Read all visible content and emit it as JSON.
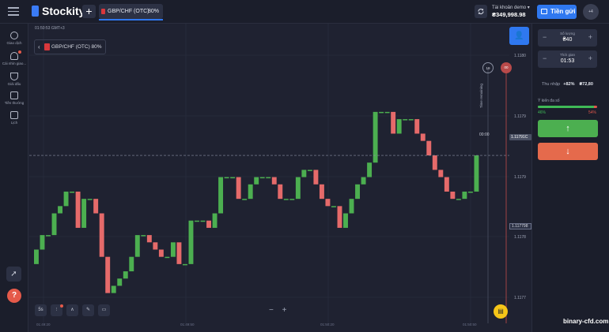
{
  "header": {
    "logo_text": "Stockity",
    "add_tab_label": "+",
    "active_tab": {
      "label": "GBP/CHF (OTC)",
      "payout": "80%"
    },
    "account_label": "Tài khoản demo ▾",
    "balance": "₴349,998.98",
    "deposit_label": "Tiền gửi",
    "avatar_label": "+4"
  },
  "sidebar": {
    "items": [
      {
        "label": "Giao dịch",
        "icon": "clock-icon"
      },
      {
        "label": "Cái nhìn giao...",
        "icon": "award-icon"
      },
      {
        "label": "Giải đấu",
        "icon": "trophy-icon"
      },
      {
        "label": "Tiền thưởng",
        "icon": "gift-icon"
      },
      {
        "label": "Lịch",
        "icon": "calendar-icon"
      }
    ],
    "rocket_icon": "rocket-icon",
    "help_label": "?"
  },
  "chart": {
    "clock": "01:50:53 GMT+3",
    "asset_label": "GBP/CHF (OTC) 80%",
    "time_remaining": "Time remaining",
    "timer": "00:00",
    "badge_gray": "19",
    "badge_red": "00",
    "current_price": "1.11791C",
    "marked_price": "1.117798",
    "timeframe": "5s",
    "zoom_minus": "−",
    "zoom_plus": "+",
    "price_ticks": [
      "1.1180",
      "1.1179",
      "1.1179",
      "1.1178",
      "1.1177"
    ],
    "time_ticks": [
      "01:49:20",
      "01:49:50",
      "01:50:20",
      "01:50:50"
    ]
  },
  "panel": {
    "amount": {
      "label": "Số lượng",
      "value": "₴40"
    },
    "duration": {
      "label": "Thời gian",
      "value": "01:53"
    },
    "payout_label": "Thu nhập",
    "payout_pct": "+82%",
    "payout_value": "₴72,80",
    "sentiment_label": "Ý kiến đa số",
    "sentiment_up": "46%",
    "sentiment_down": "54%",
    "sentiment_up_fraction": 0.95,
    "up_arrow": "↑",
    "down_arrow": "↓"
  },
  "watermark": "binary-cfd.com",
  "colors": {
    "up": "#4caf50",
    "down": "#e56a4c",
    "accent": "#2f78f0",
    "bg": "#1f2231"
  },
  "chart_data": {
    "type": "candlestick",
    "ylim": [
      1.11768,
      1.11805
    ],
    "candles": [
      {
        "o": 1.11774,
        "c": 1.11776
      },
      {
        "o": 1.11776,
        "c": 1.11778
      },
      {
        "o": 1.11778,
        "c": 1.11778
      },
      {
        "o": 1.11778,
        "c": 1.11781
      },
      {
        "o": 1.11781,
        "c": 1.11782
      },
      {
        "o": 1.11782,
        "c": 1.11784
      },
      {
        "o": 1.11784,
        "c": 1.11784
      },
      {
        "o": 1.11784,
        "c": 1.11779
      },
      {
        "o": 1.11779,
        "c": 1.11783
      },
      {
        "o": 1.11783,
        "c": 1.11783
      },
      {
        "o": 1.11783,
        "c": 1.11781
      },
      {
        "o": 1.11781,
        "c": 1.11775
      },
      {
        "o": 1.11775,
        "c": 1.1177
      },
      {
        "o": 1.1177,
        "c": 1.11771
      },
      {
        "o": 1.11771,
        "c": 1.11772
      },
      {
        "o": 1.11772,
        "c": 1.11773
      },
      {
        "o": 1.11773,
        "c": 1.11775
      },
      {
        "o": 1.11775,
        "c": 1.11778
      },
      {
        "o": 1.11778,
        "c": 1.11778
      },
      {
        "o": 1.11778,
        "c": 1.11777
      },
      {
        "o": 1.11777,
        "c": 1.11776
      },
      {
        "o": 1.11776,
        "c": 1.11775
      },
      {
        "o": 1.11775,
        "c": 1.11775
      },
      {
        "o": 1.11775,
        "c": 1.11777
      },
      {
        "o": 1.11777,
        "c": 1.11774
      },
      {
        "o": 1.11774,
        "c": 1.11774
      },
      {
        "o": 1.11774,
        "c": 1.1178
      },
      {
        "o": 1.1178,
        "c": 1.1178
      },
      {
        "o": 1.1178,
        "c": 1.1178
      },
      {
        "o": 1.1178,
        "c": 1.11779
      },
      {
        "o": 1.11779,
        "c": 1.11781
      },
      {
        "o": 1.11781,
        "c": 1.11786
      },
      {
        "o": 1.11786,
        "c": 1.11786
      },
      {
        "o": 1.11786,
        "c": 1.11786
      },
      {
        "o": 1.11786,
        "c": 1.11783
      },
      {
        "o": 1.11783,
        "c": 1.11783
      },
      {
        "o": 1.11783,
        "c": 1.11785
      },
      {
        "o": 1.11785,
        "c": 1.11786
      },
      {
        "o": 1.11786,
        "c": 1.11786
      },
      {
        "o": 1.11786,
        "c": 1.11786
      },
      {
        "o": 1.11786,
        "c": 1.11785
      },
      {
        "o": 1.11785,
        "c": 1.11783
      },
      {
        "o": 1.11783,
        "c": 1.11783
      },
      {
        "o": 1.11783,
        "c": 1.11783
      },
      {
        "o": 1.11783,
        "c": 1.11786
      },
      {
        "o": 1.11786,
        "c": 1.11787
      },
      {
        "o": 1.11787,
        "c": 1.11787
      },
      {
        "o": 1.11787,
        "c": 1.11785
      },
      {
        "o": 1.11785,
        "c": 1.11783
      },
      {
        "o": 1.11783,
        "c": 1.11782
      },
      {
        "o": 1.11782,
        "c": 1.11782
      },
      {
        "o": 1.11782,
        "c": 1.11779
      },
      {
        "o": 1.11779,
        "c": 1.11781
      },
      {
        "o": 1.11781,
        "c": 1.11783
      },
      {
        "o": 1.11783,
        "c": 1.11785
      },
      {
        "o": 1.11785,
        "c": 1.11786
      },
      {
        "o": 1.11786,
        "c": 1.11788
      },
      {
        "o": 1.11788,
        "c": 1.11795
      },
      {
        "o": 1.11795,
        "c": 1.11795
      },
      {
        "o": 1.11795,
        "c": 1.11795
      },
      {
        "o": 1.11795,
        "c": 1.11792
      },
      {
        "o": 1.11792,
        "c": 1.11794
      },
      {
        "o": 1.11794,
        "c": 1.11794
      },
      {
        "o": 1.11794,
        "c": 1.11794
      },
      {
        "o": 1.11794,
        "c": 1.11792
      },
      {
        "o": 1.11792,
        "c": 1.11791
      },
      {
        "o": 1.11791,
        "c": 1.11789
      },
      {
        "o": 1.11789,
        "c": 1.11787
      },
      {
        "o": 1.11787,
        "c": 1.11786
      },
      {
        "o": 1.11786,
        "c": 1.11784
      },
      {
        "o": 1.11784,
        "c": 1.11783
      },
      {
        "o": 1.11783,
        "c": 1.11783
      },
      {
        "o": 1.11783,
        "c": 1.11784
      },
      {
        "o": 1.11784,
        "c": 1.11784
      },
      {
        "o": 1.11784,
        "c": 1.11789
      }
    ]
  }
}
